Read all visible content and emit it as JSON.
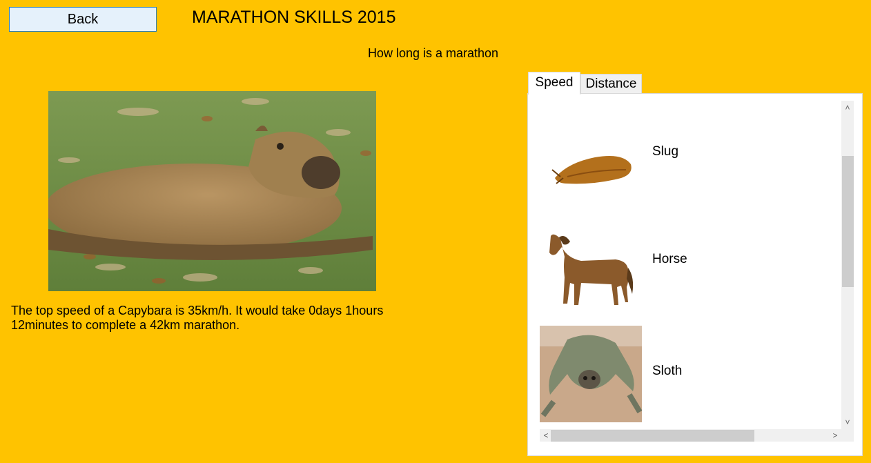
{
  "header": {
    "back_label": "Back",
    "title": "MARATHON SKILLS 2015"
  },
  "subtitle": "How long is a marathon",
  "main": {
    "image_subject": "capybara",
    "result_text": "The top speed of a Capybara is 35km/h. It would take 0days 1hours 12minutes to complete a 42km marathon."
  },
  "tabs": [
    {
      "label": "Speed",
      "selected": true
    },
    {
      "label": "Distance",
      "selected": false
    }
  ],
  "animal_list": [
    {
      "name": "Slug"
    },
    {
      "name": "Horse"
    },
    {
      "name": "Sloth"
    }
  ],
  "scrollbars": {
    "vertical_up_icon": "chevron-up-icon",
    "vertical_down_icon": "chevron-down-icon",
    "horizontal_left_icon": "chevron-left-icon",
    "horizontal_right_icon": "chevron-right-icon"
  },
  "colors": {
    "background": "#FFC300",
    "button_bg": "#E5F1FB",
    "button_border": "#2F7FB6"
  }
}
